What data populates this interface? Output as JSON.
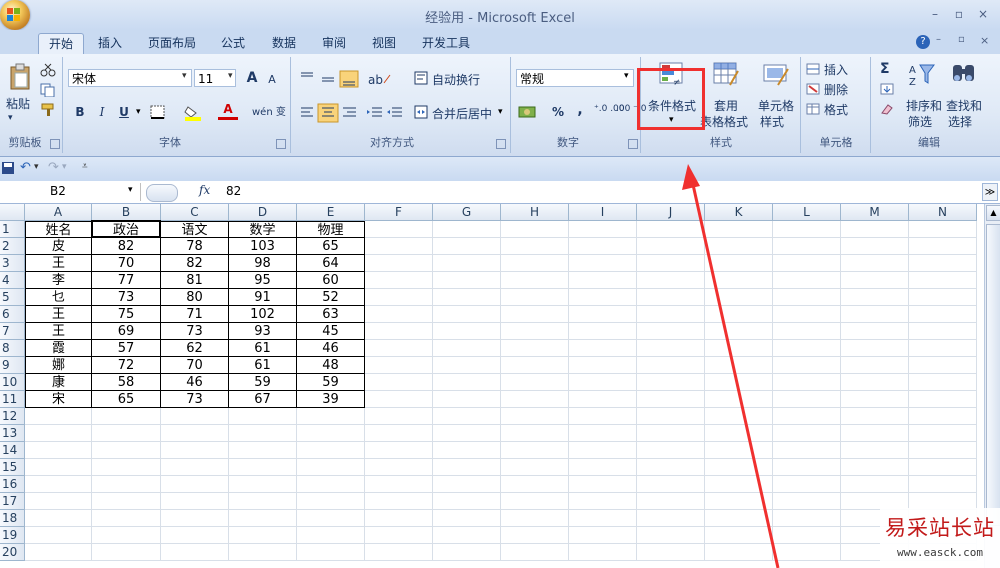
{
  "window": {
    "title": "经验用 - Microsoft Excel",
    "controls": [
      "–",
      "▫",
      "×"
    ]
  },
  "tabs": [
    "开始",
    "插入",
    "页面布局",
    "公式",
    "数据",
    "审阅",
    "视图",
    "开发工具"
  ],
  "ribbon": {
    "clipboard": {
      "label": "剪贴板",
      "paste": "粘贴"
    },
    "font": {
      "label": "字体",
      "name": "宋体",
      "size": "11",
      "grow": "A",
      "shrink": "A",
      "bold": "B",
      "italic": "I",
      "underline": "U",
      "fontcolor": "A",
      "phonetic": "wén 变"
    },
    "align": {
      "label": "对齐方式",
      "wrap": "自动换行",
      "merge": "合并后居中"
    },
    "number": {
      "label": "数字",
      "format": "常规",
      "percent": "%",
      "comma": ",",
      "inc": "⁺.0 .00",
      "dec": ".00 ⁻.0"
    },
    "styles": {
      "label": "样式",
      "conditional": "条件格式",
      "table_l1": "套用",
      "table_l2": "表格格式",
      "cell_l1": "单元格",
      "cell_l2": "样式"
    },
    "cells": {
      "label": "单元格",
      "insert": "插入",
      "delete": "删除",
      "format": "格式"
    },
    "editing": {
      "label": "编辑",
      "sort_l1": "排序和",
      "sort_l2": "筛选",
      "find_l1": "查找和",
      "find_l2": "选择"
    }
  },
  "formula_bar": {
    "name_box": "B2",
    "fx": "fx",
    "value": "82"
  },
  "columns": [
    "A",
    "B",
    "C",
    "D",
    "E",
    "F",
    "G",
    "H",
    "I",
    "J",
    "K",
    "L",
    "M",
    "N"
  ],
  "rows": [
    "1",
    "2",
    "3",
    "4",
    "5",
    "6",
    "7",
    "8",
    "9",
    "10",
    "11",
    "12",
    "13",
    "14",
    "15",
    "16",
    "17",
    "18",
    "19",
    "20"
  ],
  "table": [
    [
      "姓名",
      "政治",
      "语文",
      "数学",
      "物理"
    ],
    [
      "皮",
      "82",
      "78",
      "103",
      "65"
    ],
    [
      "王",
      "70",
      "82",
      "98",
      "64"
    ],
    [
      "李",
      "77",
      "81",
      "95",
      "60"
    ],
    [
      "乜",
      "73",
      "80",
      "91",
      "52"
    ],
    [
      "王",
      "75",
      "71",
      "102",
      "63"
    ],
    [
      "王",
      "69",
      "73",
      "93",
      "45"
    ],
    [
      "霞",
      "57",
      "62",
      "61",
      "46"
    ],
    [
      "娜",
      "72",
      "70",
      "61",
      "48"
    ],
    [
      "康",
      "58",
      "46",
      "59",
      "59"
    ],
    [
      "宋",
      "65",
      "73",
      "67",
      "39"
    ]
  ],
  "watermark": {
    "brand": "易采站长站",
    "url": "www.easck.com"
  },
  "colors": {
    "accent": "#f0302f",
    "ribbon": "#dfe9f6",
    "header": "#dfe7f2"
  }
}
